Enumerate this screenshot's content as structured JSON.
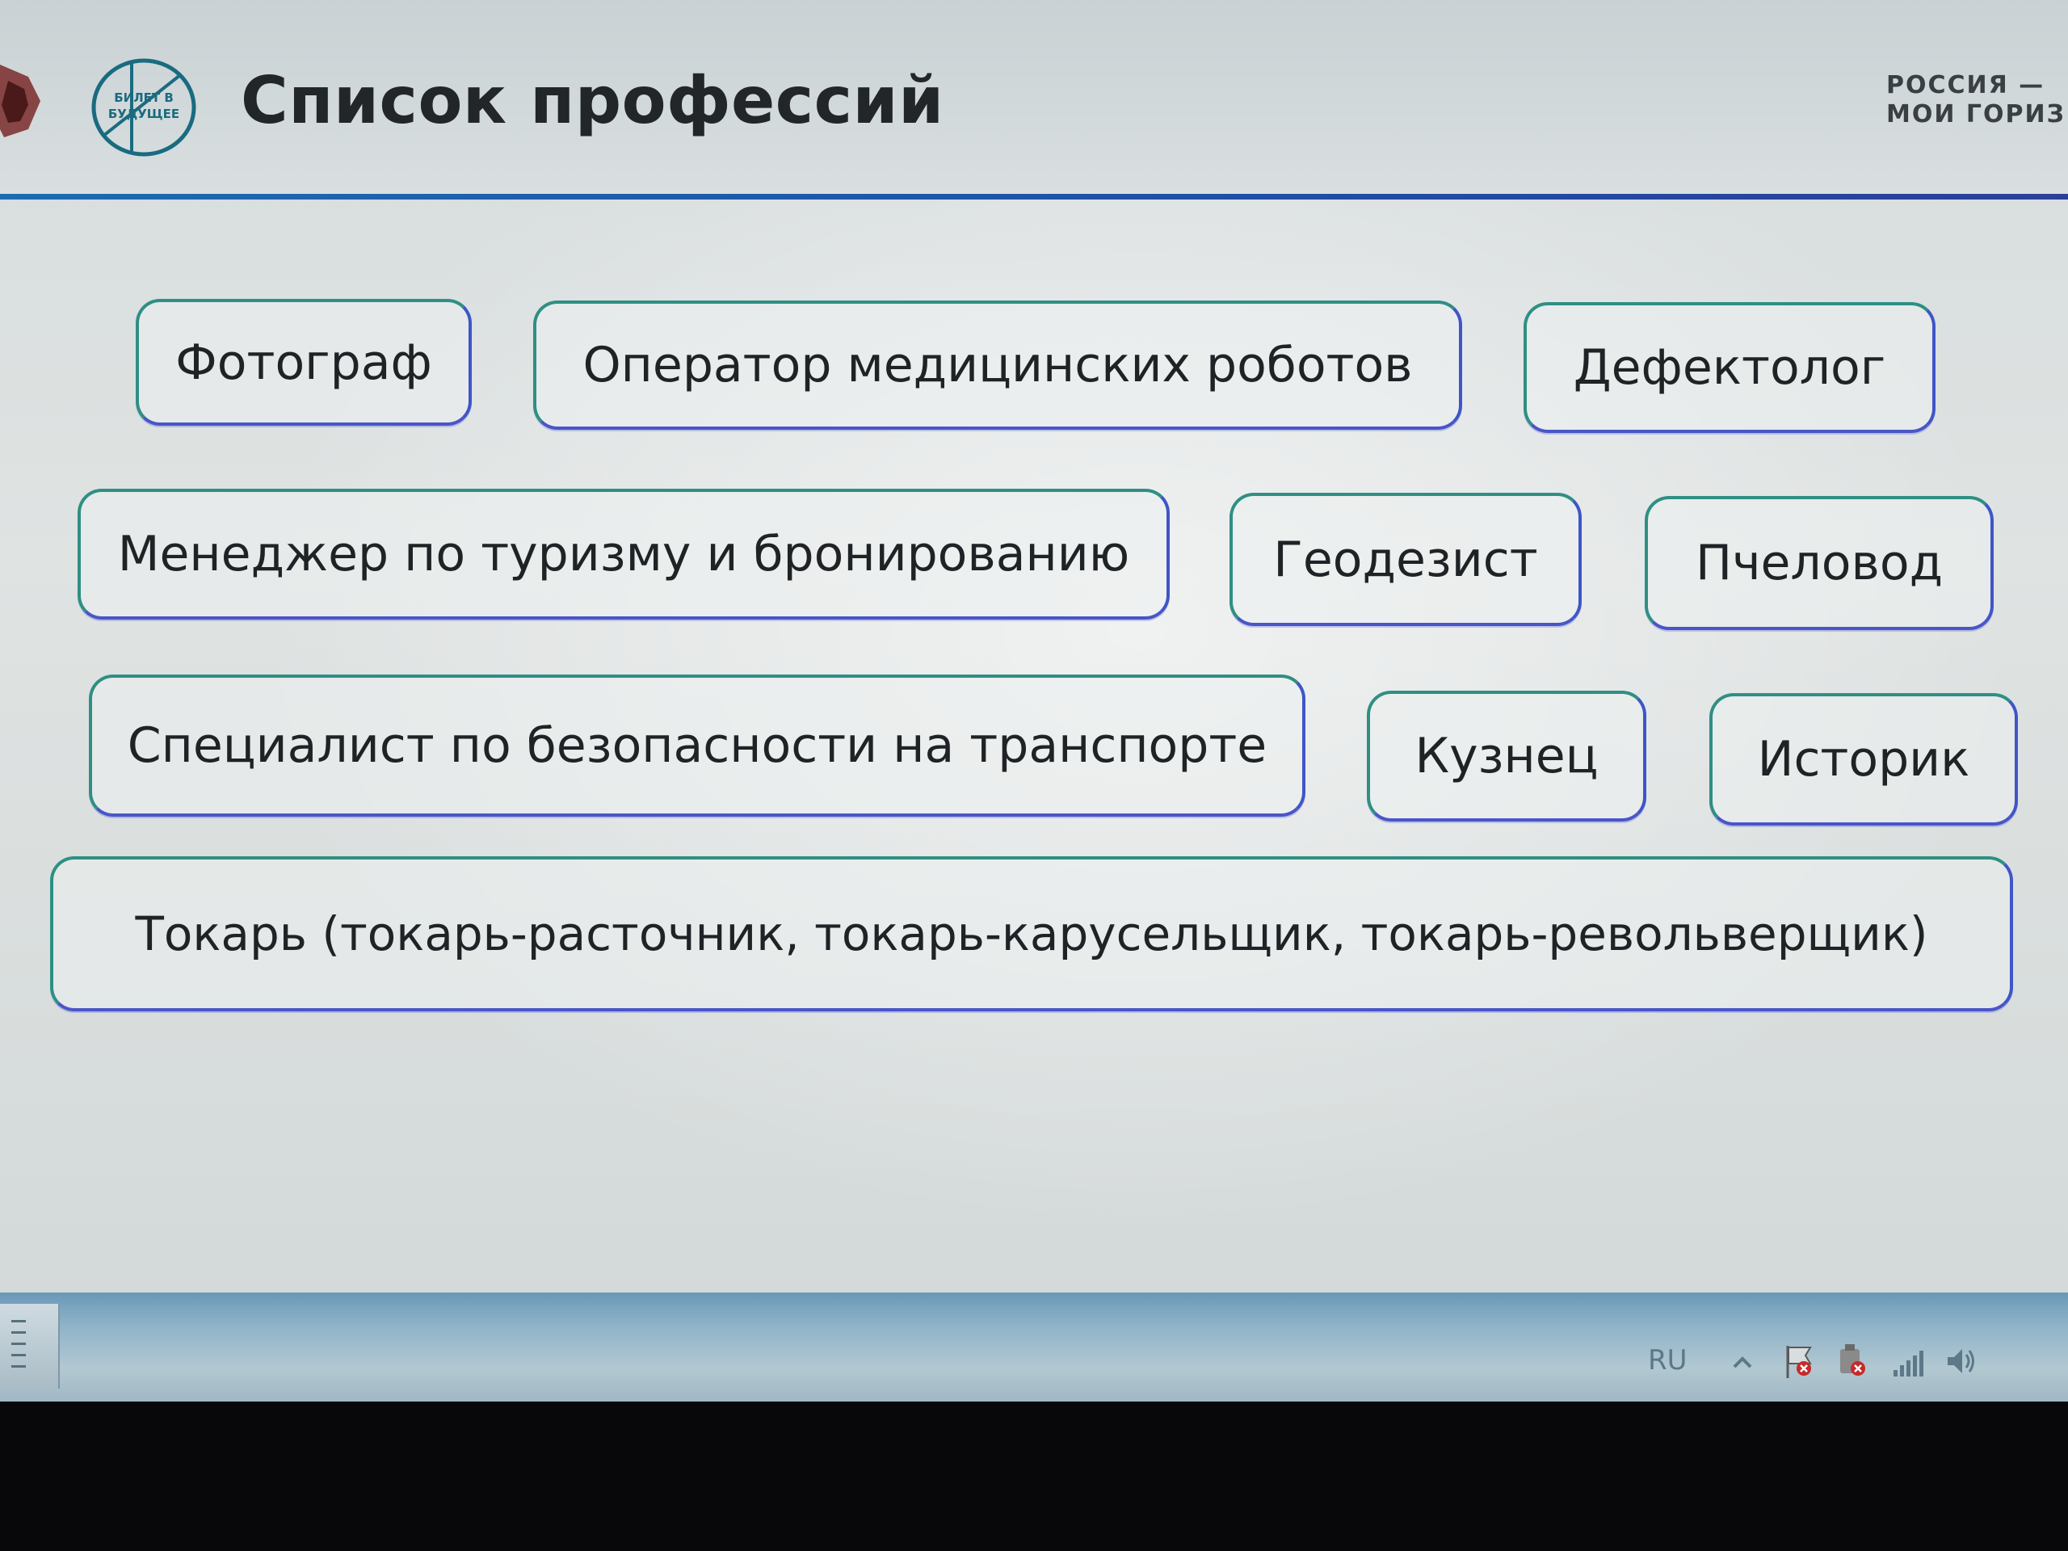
{
  "header": {
    "title": "Список профессий",
    "logo_text": [
      "БИЛЕТ В",
      "БУДУЩЕЕ"
    ],
    "brand_lines": [
      "РОССИЯ —",
      "МОИ ГОРИЗ"
    ]
  },
  "professions": [
    "Фотограф",
    "Оператор медицинских роботов",
    "Дефектолог",
    "Менеджер по туризму и бронированию",
    "Геодезист",
    "Пчеловод",
    "Специалист по безопасности на транспорте",
    "Кузнец",
    "Историк",
    "Токарь (токарь-расточник, токарь-карусельщик, токарь-револьверщик)"
  ],
  "taskbar": {
    "language": "RU",
    "tray_icons": [
      "chevron-up-icon",
      "flag-icon",
      "power-icon",
      "signal-icon",
      "speaker-icon"
    ]
  },
  "colors": {
    "chip_border_green": "#2f8f83",
    "chip_border_blue": "#3f55c8",
    "header_line": "#1f4fa6",
    "title_text": "#222629"
  }
}
